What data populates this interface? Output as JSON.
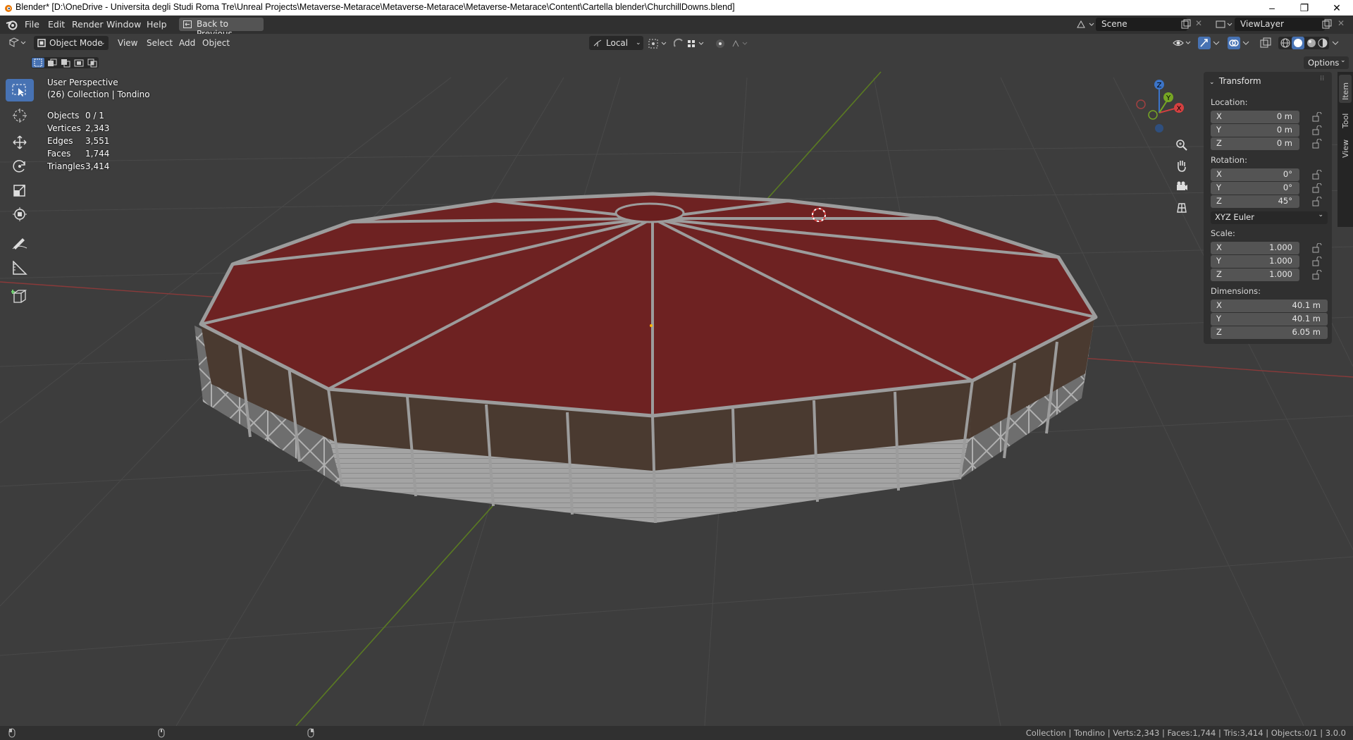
{
  "window": {
    "title": "Blender* [D:\\OneDrive - Universita degli Studi Roma Tre\\Unreal Projects\\Metaverse-Metarace\\Metaverse-Metarace\\Metaverse-Metarace\\Content\\Cartella blender\\ChurchillDowns.blend]",
    "minimize": "–",
    "maximize": "❐",
    "close": "✕"
  },
  "menu": {
    "items": [
      "File",
      "Edit",
      "Render",
      "Window",
      "Help"
    ],
    "back_button": "Back to Previous",
    "scene_field": "Scene",
    "viewlayer_field": "ViewLayer"
  },
  "viewport_header": {
    "mode": "Object Mode",
    "menus": [
      "View",
      "Select",
      "Add",
      "Object"
    ],
    "transform_orientation": "Local",
    "options": "Options"
  },
  "overlay": {
    "perspective": "User Perspective",
    "collection": "(26) Collection | Tondino",
    "stats": [
      {
        "label": "Objects",
        "value": "0 / 1"
      },
      {
        "label": "Vertices",
        "value": "2,343"
      },
      {
        "label": "Edges",
        "value": "3,551"
      },
      {
        "label": "Faces",
        "value": "1,744"
      },
      {
        "label": "Triangles",
        "value": "3,414"
      }
    ]
  },
  "gizmo": {
    "x": "X",
    "y": "Y",
    "z": "Z"
  },
  "npanel": {
    "header": "Transform",
    "location_label": "Location:",
    "location": [
      {
        "axis": "X",
        "value": "0 m"
      },
      {
        "axis": "Y",
        "value": "0 m"
      },
      {
        "axis": "Z",
        "value": "0 m"
      }
    ],
    "rotation_label": "Rotation:",
    "rotation": [
      {
        "axis": "X",
        "value": "0°"
      },
      {
        "axis": "Y",
        "value": "0°"
      },
      {
        "axis": "Z",
        "value": "45°"
      }
    ],
    "rotation_mode": "XYZ Euler",
    "scale_label": "Scale:",
    "scale": [
      {
        "axis": "X",
        "value": "1.000"
      },
      {
        "axis": "Y",
        "value": "1.000"
      },
      {
        "axis": "Z",
        "value": "1.000"
      }
    ],
    "dimensions_label": "Dimensions:",
    "dimensions": [
      {
        "axis": "X",
        "value": "40.1 m"
      },
      {
        "axis": "Y",
        "value": "40.1 m"
      },
      {
        "axis": "Z",
        "value": "6.05 m"
      }
    ],
    "tabs": [
      "Item",
      "Tool",
      "View"
    ]
  },
  "status": {
    "text": "Collection | Tondino | Verts:2,343 | Faces:1,744 | Tris:3,414 | Objects:0/1 | 3.0.0"
  },
  "colors": {
    "roof": "#6e2222",
    "frame": "#9a9a9a",
    "wall": "#4a3a30",
    "active_tool": "#4772b3"
  }
}
